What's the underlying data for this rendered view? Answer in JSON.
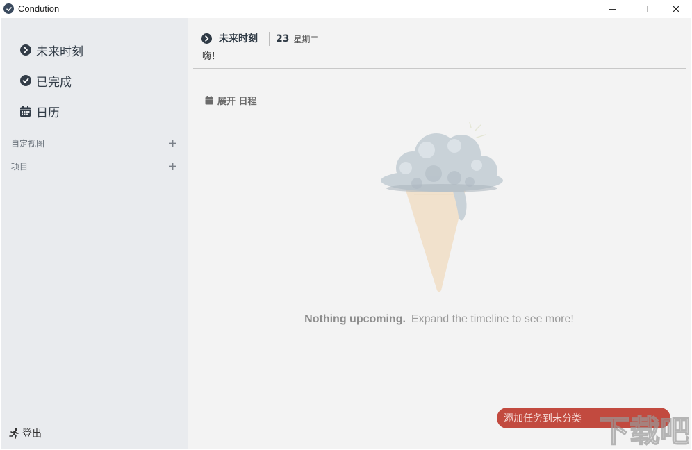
{
  "window": {
    "title": "Condution",
    "logo_icon": "check-circle-icon",
    "controls": [
      "minimize-icon",
      "maximize-icon",
      "close-icon"
    ]
  },
  "sidebar": {
    "nav": [
      {
        "label": "未来时刻",
        "icon": "chevron-right-circle-icon"
      },
      {
        "label": "已完成",
        "icon": "check-circle-icon"
      },
      {
        "label": "日历",
        "icon": "calendar-icon"
      }
    ],
    "sections": [
      {
        "label": "自定视图",
        "action_icon": "plus-icon"
      },
      {
        "label": "项目",
        "action_icon": "plus-icon"
      }
    ],
    "logout_label": "登出",
    "logout_icon": "running-person-icon",
    "background": "#e9ebee"
  },
  "main": {
    "header": {
      "title": "未来时刻",
      "icon": "chevron-right-circle-icon",
      "day": "23",
      "weekday": "星期二",
      "greeting": "嗨！"
    },
    "expand_label": "展开 日程",
    "expand_icon": "calendar-icon",
    "illustration": "melting-ice-cream-icon",
    "empty_state": {
      "title": "Nothing upcoming.",
      "subtitle": "Expand the timeline to see more!"
    },
    "add_button_label": "添加任务到未分类",
    "background": "#f3f3f3"
  },
  "colors": {
    "accent": "#c24a3f",
    "icon_dark": "#333d48"
  },
  "watermark_text": "下载吧"
}
